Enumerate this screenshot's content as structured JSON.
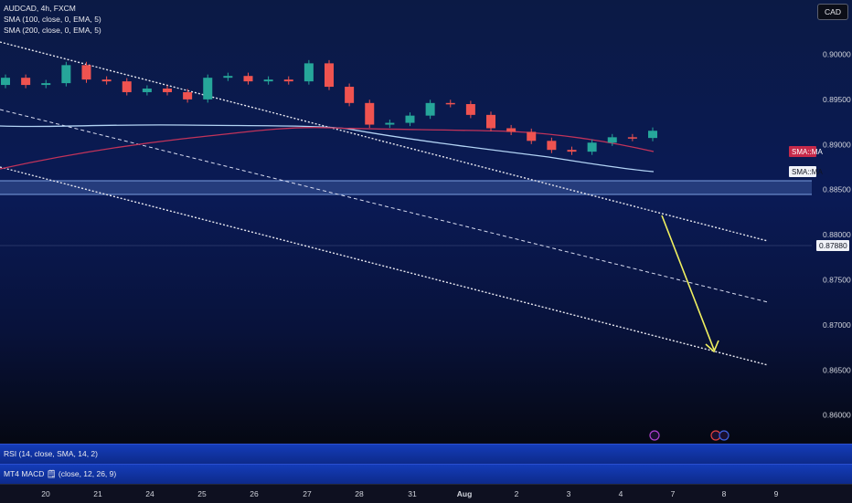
{
  "header": {
    "title": "AUDCAD, 4h, FXCM",
    "ma1": "SMA (100, close, 0, EMA, 5)",
    "ma2": "SMA (200, close, 0, EMA, 5)",
    "currency": "CAD"
  },
  "price_axis": {
    "ticks": [
      "0.90000",
      "0.89500",
      "0.89000",
      "0.88500",
      "0.88000",
      "0.87500",
      "0.87000",
      "0.86500",
      "0.86000"
    ],
    "current_price": "0.87880",
    "ma_badges": [
      "SMA::MA",
      "SMA::MA"
    ]
  },
  "time_axis": {
    "labels": [
      "20",
      "21",
      "24",
      "25",
      "26",
      "27",
      "28",
      "31",
      "Aug",
      "2",
      "3",
      "4",
      "7",
      "8",
      "9"
    ]
  },
  "indicator_panes": {
    "rsi": "RSI (14, close, SMA, 14, 2)",
    "macd": "MT4 MACD 🗒 (close, 12, 26, 9)"
  },
  "colors": {
    "bull": "#26a69a",
    "bear": "#ef5350",
    "arrow": "#f0f060",
    "sma100": "#b3d4f5",
    "sma200": "#c2335a"
  },
  "chart_data": {
    "type": "candlestick",
    "symbol": "AUDCAD",
    "timeframe": "4h",
    "ylim": [
      0.8575,
      0.9025
    ],
    "approx_close_path": [
      0.8935,
      0.8915,
      0.892,
      0.897,
      0.893,
      0.8925,
      0.8895,
      0.8905,
      0.8895,
      0.8875,
      0.8935,
      0.894,
      0.8925,
      0.893,
      0.8925,
      0.8975,
      0.891,
      0.8865,
      0.8805,
      0.881,
      0.883,
      0.8865,
      0.8862,
      0.8832,
      0.8795,
      0.8785,
      0.876,
      0.8735,
      0.873,
      0.8755,
      0.877,
      0.8768,
      0.8788
    ],
    "current_price": 0.8788
  }
}
